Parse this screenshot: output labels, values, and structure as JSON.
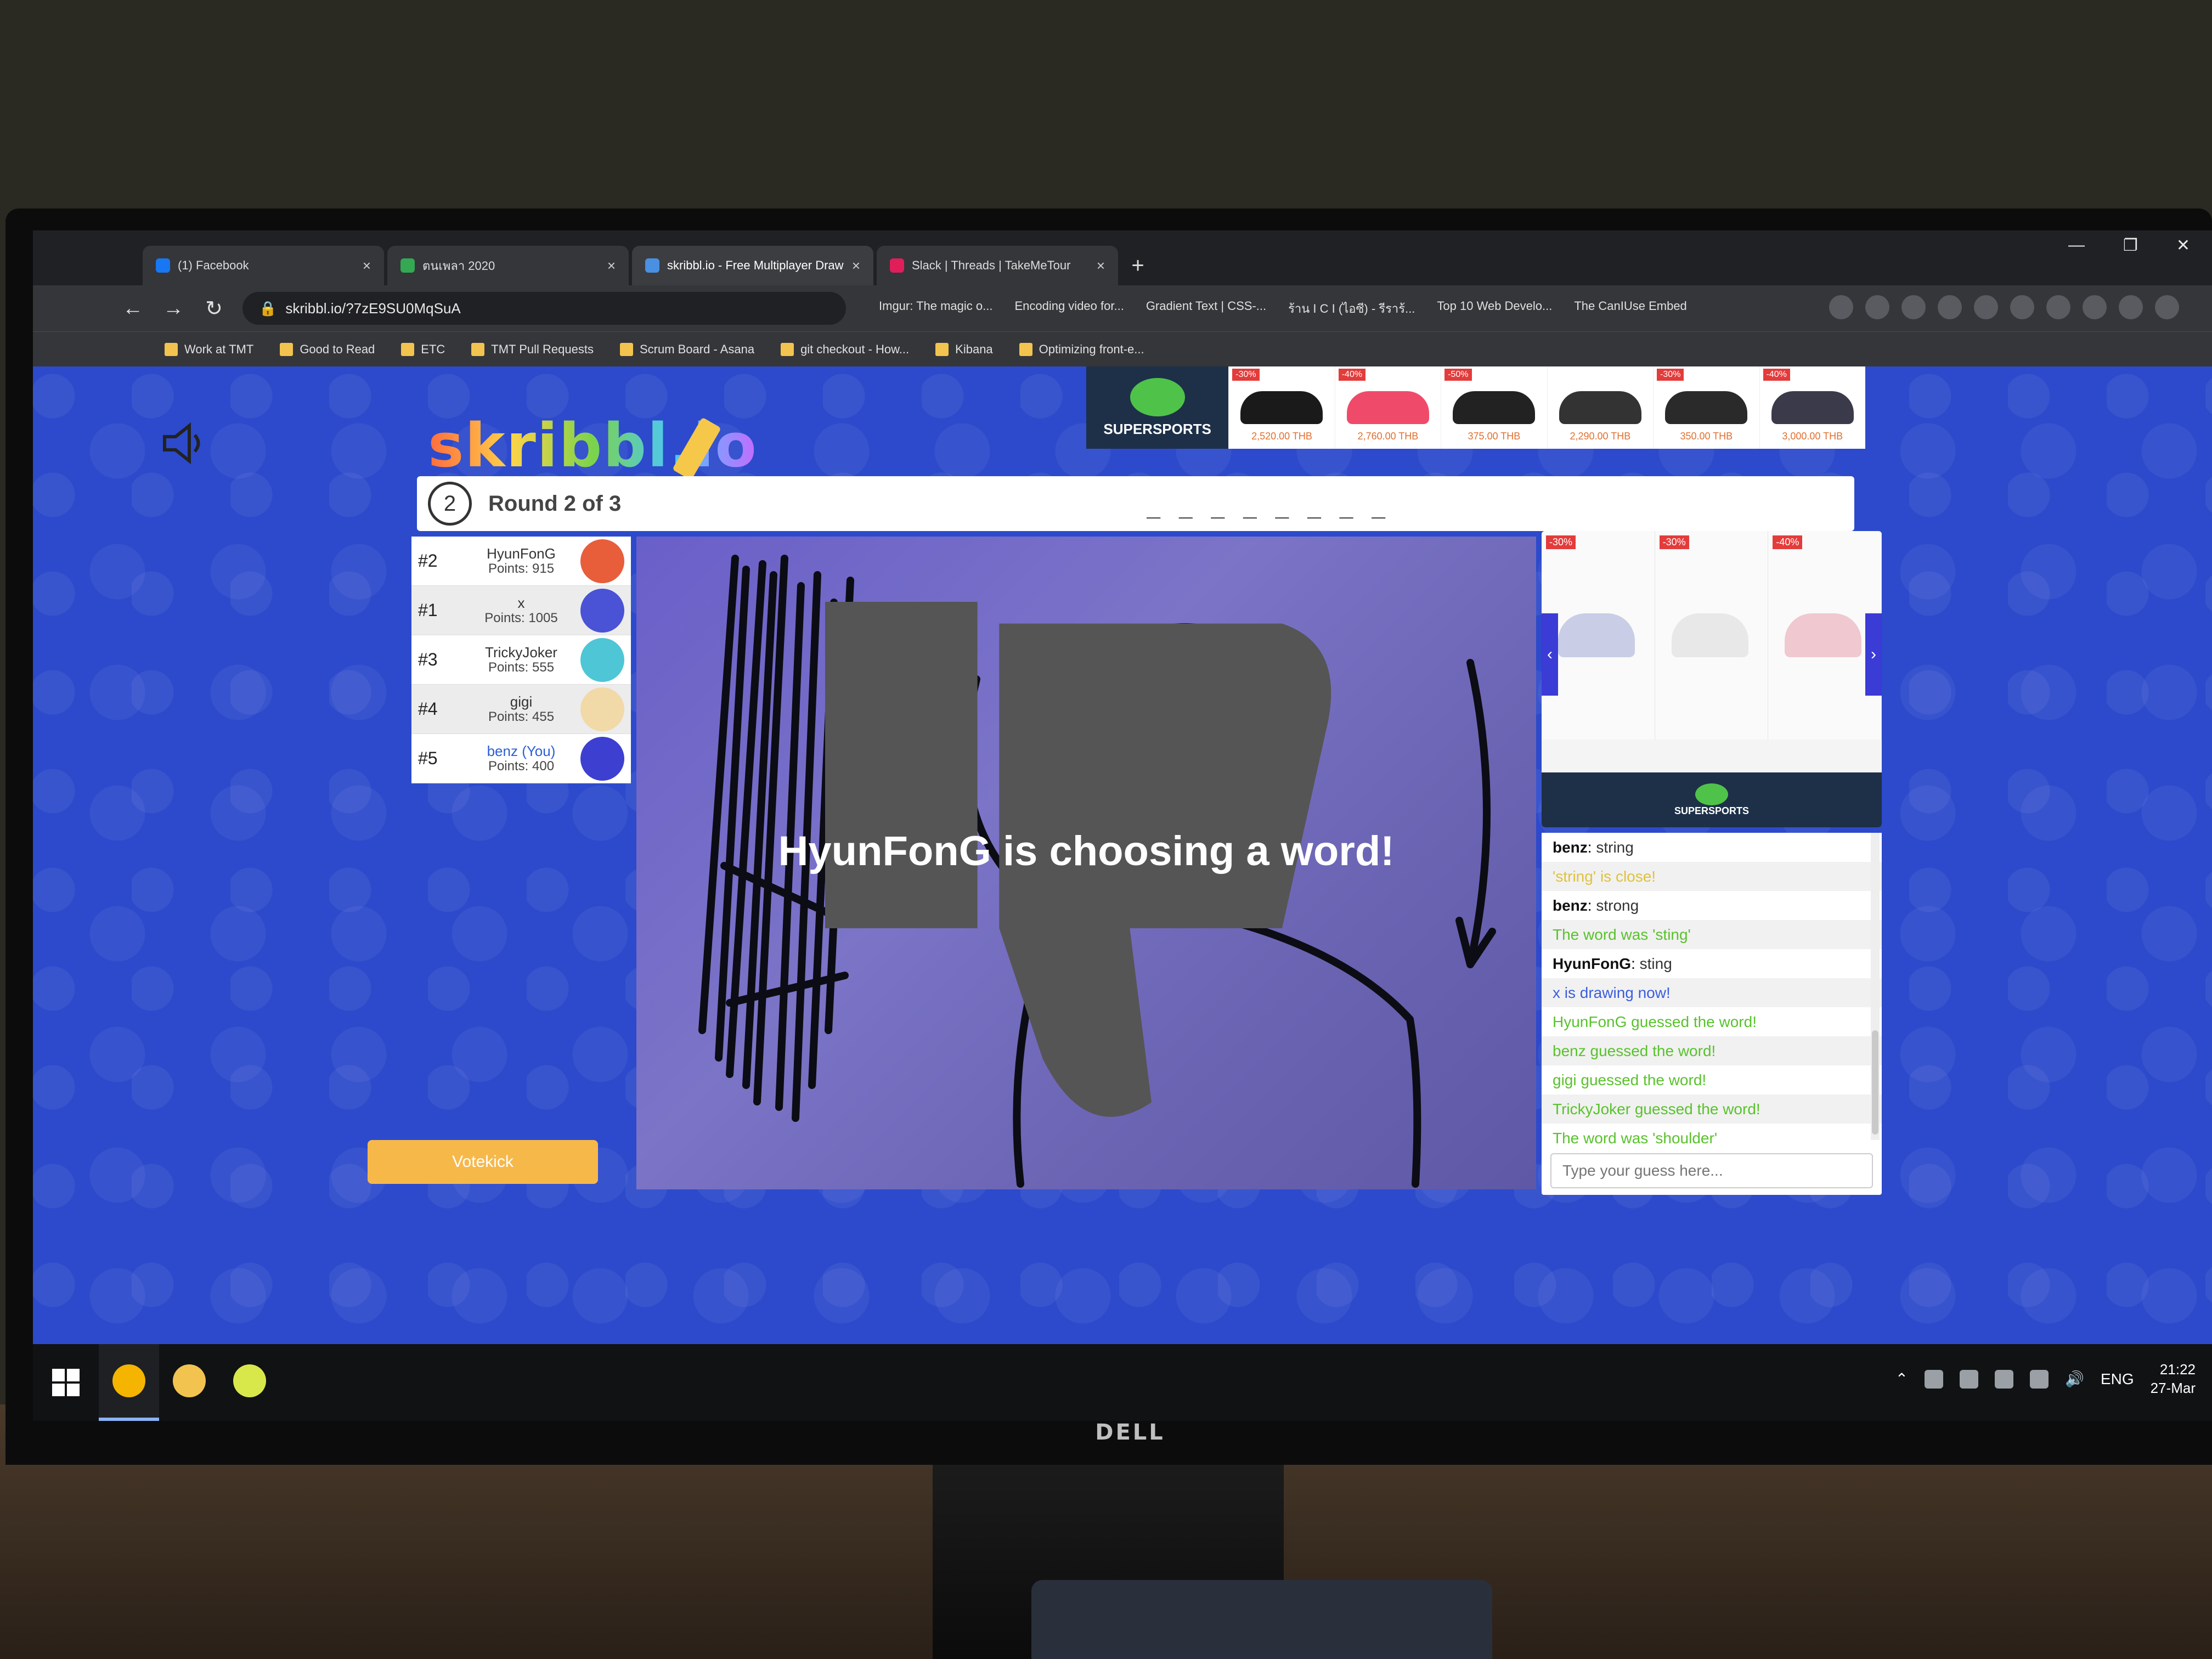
{
  "browser": {
    "tabs": [
      {
        "title": "(1) Facebook",
        "favicon": "facebook-icon",
        "color": "#1877f2",
        "active": false
      },
      {
        "title": "ตนเพลา 2020",
        "favicon": "sheet-icon",
        "color": "#34a853",
        "active": false
      },
      {
        "title": "skribbl.io - Free Multiplayer Draw",
        "favicon": "skribbl-icon",
        "color": "#4a90e2",
        "active": true
      },
      {
        "title": "Slack | Threads | TakeMeTour",
        "favicon": "slack-icon",
        "color": "#e01e5a",
        "active": false
      }
    ],
    "new_tab_label": "+",
    "url": "skribbl.io/?7zE9SU0MqSuA",
    "inline_bookmarks": [
      "Imgur: The magic o...",
      "Encoding video for...",
      "Gradient Text | CSS-...",
      "ร้าน I C I (ไอซี) - รีราร้...",
      "Top 10 Web Develo...",
      "The CanIUse Embed"
    ],
    "bookmarks": [
      "Work at TMT",
      "Good to Read",
      "ETC",
      "TMT Pull Requests",
      "Scrum Board - Asana",
      "git checkout - How...",
      "Kibana",
      "Optimizing front-e..."
    ]
  },
  "game": {
    "logo_text": "skribbl.io",
    "round_number": "2",
    "round_label": "Round 2 of 3",
    "word_hint": "_ _ _ _ _ _ _ _",
    "players": [
      {
        "rank": "#2",
        "name": "HyunFonG",
        "points": "Points: 915",
        "avatar_color": "#e85d3a",
        "you": false
      },
      {
        "rank": "#1",
        "name": "x",
        "points": "Points: 1005",
        "avatar_color": "#4a52d6",
        "you": false
      },
      {
        "rank": "#3",
        "name": "TrickyJoker",
        "points": "Points: 555",
        "avatar_color": "#4ec6d6",
        "you": false
      },
      {
        "rank": "#4",
        "name": "gigi",
        "points": "Points: 455",
        "avatar_color": "#f1d9a8",
        "you": false
      },
      {
        "rank": "#5",
        "name": "benz (You)",
        "points": "Points: 400",
        "avatar_color": "#3d3fd0",
        "you": true
      }
    ],
    "overlay_message": "HyunFonG is choosing a word!",
    "votekick_label": "Votekick",
    "chat": [
      {
        "name": "benz",
        "text": "string",
        "kind": "user"
      },
      {
        "name": "",
        "text": "'string' is close!",
        "kind": "close"
      },
      {
        "name": "benz",
        "text": "strong",
        "kind": "user"
      },
      {
        "name": "",
        "text": "The word was 'sting'",
        "kind": "sys"
      },
      {
        "name": "HyunFonG",
        "text": "sting",
        "kind": "user"
      },
      {
        "name": "",
        "text": "x is drawing now!",
        "kind": "blue"
      },
      {
        "name": "",
        "text": "HyunFonG guessed the word!",
        "kind": "sys"
      },
      {
        "name": "",
        "text": "benz guessed the word!",
        "kind": "sys"
      },
      {
        "name": "",
        "text": "gigi guessed the word!",
        "kind": "sys"
      },
      {
        "name": "",
        "text": "TrickyJoker guessed the word!",
        "kind": "sys"
      },
      {
        "name": "",
        "text": "The word was 'shoulder'",
        "kind": "sys"
      }
    ],
    "chat_placeholder": "Type your guess here..."
  },
  "ads": {
    "brand": "SUPERSPORTS",
    "top_items": [
      {
        "badge": "-30%",
        "price": "2,520.00 THB",
        "color": "#1a1a1a"
      },
      {
        "badge": "-40%",
        "price": "2,760.00 THB",
        "color": "#f04a6a"
      },
      {
        "badge": "-50%",
        "price": "375.00 THB",
        "color": "#222"
      },
      {
        "badge": "",
        "price": "2,290.00 THB",
        "color": "#333"
      },
      {
        "badge": "-30%",
        "price": "350.00 THB",
        "color": "#2a2a2a"
      },
      {
        "badge": "-40%",
        "price": "3,000.00 THB",
        "color": "#3a3a4a"
      }
    ],
    "side_items": [
      {
        "badge": "-30%",
        "color": "#c9cde6"
      },
      {
        "badge": "-30%",
        "color": "#e8e8e8"
      },
      {
        "badge": "-40%",
        "color": "#f0c8d0"
      }
    ]
  },
  "taskbar": {
    "apps": [
      {
        "name": "chrome",
        "color": "#f4b400",
        "active": true
      },
      {
        "name": "file-explorer",
        "color": "#f2c44f",
        "active": false
      },
      {
        "name": "app",
        "color": "#d8e84a",
        "active": false
      }
    ],
    "lang": "ENG",
    "time": "21:22",
    "date": "27-Mar"
  }
}
